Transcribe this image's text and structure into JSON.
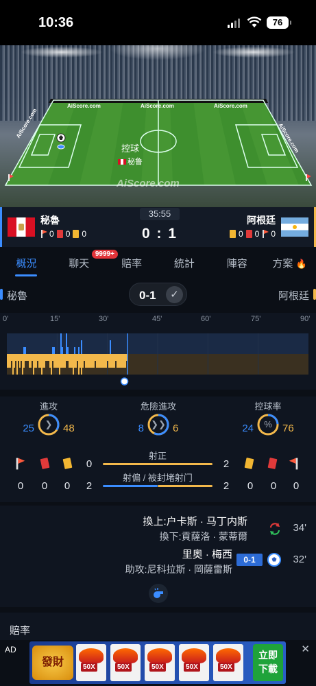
{
  "status_bar": {
    "time": "10:36",
    "battery": "76"
  },
  "stadium": {
    "ad_boards": [
      "AiScore.com",
      "AiScore.com",
      "AiScore.com",
      "AiScore.com",
      "AiScore.com"
    ],
    "possession_label": "控球",
    "possession_team": "秘鲁",
    "watermark": "AiScore.com"
  },
  "score_bar": {
    "home": {
      "name": "秘魯",
      "corners": "0",
      "red": "0",
      "yellow": "0"
    },
    "away": {
      "name": "阿根廷",
      "corners": "0",
      "red": "0",
      "yellow": "0"
    },
    "clock": "35:55",
    "score": "0 : 1"
  },
  "tabs": [
    {
      "label": "概況",
      "active": true
    },
    {
      "label": "聊天",
      "badge": "9999+"
    },
    {
      "label": "賠率"
    },
    {
      "label": "統計"
    },
    {
      "label": "陣容"
    },
    {
      "label": "方案",
      "icon": "fire-icon"
    }
  ],
  "match": {
    "home": "秘魯",
    "away": "阿根廷",
    "score": "0-1",
    "status_icon": "check-icon"
  },
  "timeline": {
    "ticks": [
      "0'",
      "15'",
      "30'",
      "45'",
      "60'",
      "75'",
      "90'"
    ],
    "current_minute": 36,
    "goal_minute": 32,
    "home_pressure": [
      0,
      0,
      0,
      0,
      0,
      0,
      0,
      0,
      0,
      0,
      0,
      0,
      1,
      1,
      0,
      0,
      0,
      0,
      0,
      0,
      0,
      0,
      0,
      0,
      0,
      0,
      0,
      0,
      0,
      0,
      0,
      0,
      0,
      1,
      1,
      0,
      0,
      0,
      0,
      3,
      1,
      0,
      0,
      3,
      1,
      0,
      0,
      0,
      0,
      1,
      0,
      0,
      1,
      0,
      2,
      0,
      0,
      0,
      0,
      0,
      0,
      0,
      0,
      0,
      0,
      0,
      0,
      0,
      0,
      0,
      0,
      0,
      0,
      0,
      0,
      2,
      0,
      0,
      0,
      0,
      0,
      0,
      0,
      0,
      0,
      0,
      0,
      0,
      0
    ],
    "away_pressure": [
      2,
      2,
      2,
      1,
      3,
      2,
      1,
      3,
      1,
      2,
      1,
      3,
      2,
      1,
      1,
      1,
      2,
      2,
      1,
      3,
      2,
      2,
      1,
      2,
      2,
      3,
      2,
      2,
      1,
      1,
      1,
      2,
      3,
      1,
      2,
      2,
      2,
      2,
      3,
      2,
      2,
      2,
      2,
      1,
      1,
      2,
      2,
      2,
      3,
      2,
      2,
      1,
      3,
      2,
      3,
      2,
      1,
      2,
      2,
      2,
      2,
      2,
      2,
      2,
      1,
      2,
      2,
      2,
      2,
      2,
      2,
      2,
      2,
      1,
      2,
      2,
      2,
      2,
      2,
      1,
      2,
      2,
      2,
      2,
      2,
      2,
      2,
      1
    ]
  },
  "stats": {
    "attack": {
      "label": "進攻",
      "home": "25",
      "away": "48",
      "home_share": 0.34
    },
    "dangerous": {
      "label": "危險進攻",
      "home": "8",
      "away": "6",
      "home_share": 0.57
    },
    "possession": {
      "label": "控球率",
      "home": "24",
      "away": "76",
      "home_share": 0.24,
      "icon_text": "%"
    },
    "shots_on_target": {
      "label": "射正",
      "home": "0",
      "away": "2",
      "home_share": 0.0
    },
    "shots_off": {
      "label": "射偏 / 被封堵射门",
      "home": "2",
      "away": "2",
      "home_share": 0.5
    },
    "home_cards": {
      "corners": "0",
      "red": "0",
      "yellow": "0"
    },
    "away_cards": {
      "yellow": "0",
      "red": "0",
      "corners": "0"
    }
  },
  "events": [
    {
      "line1": "換上:户卡斯 · 马丁内斯",
      "line2": "換下:貢薩洛 · 蒙蒂爾",
      "minute": "34'",
      "type": "substitution-icon"
    },
    {
      "line1": "里奧 · 梅西",
      "line2": "助攻:尼科拉斯 · 岡薩雷斯",
      "minute": "32'",
      "score": "0-1",
      "type": "goal-icon"
    }
  ],
  "odds": {
    "title": "賠率"
  },
  "ad": {
    "label": "AD",
    "logo_text": "發財",
    "multipliers": [
      "50X",
      "50X",
      "50X",
      "50X",
      "50X"
    ],
    "cta": [
      "立即",
      "下載"
    ],
    "close": "✕"
  },
  "colors": {
    "home": "#3b8dff",
    "away": "#f2b84b",
    "accent": "#3b8dff"
  }
}
